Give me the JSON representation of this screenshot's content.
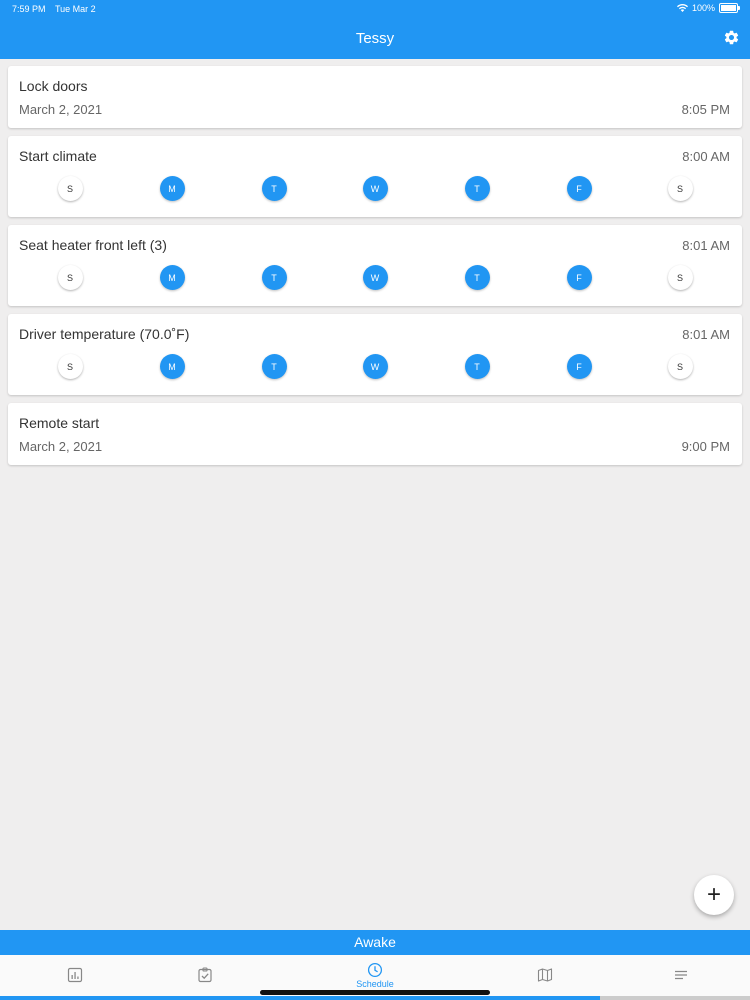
{
  "status": {
    "time": "7:59 PM",
    "date": "Tue Mar 2",
    "battery": "100%"
  },
  "header": {
    "title": "Tessy",
    "settings_icon": "gear-icon"
  },
  "day_letters": [
    "S",
    "M",
    "T",
    "W",
    "T",
    "F",
    "S"
  ],
  "schedules": [
    {
      "name": "Lock doors",
      "date": "March 2, 2021",
      "time": "8:05 PM"
    },
    {
      "name": "Start climate",
      "time": "8:00 AM",
      "days_active": [
        false,
        true,
        true,
        true,
        true,
        true,
        false
      ]
    },
    {
      "name": "Seat heater front left (3)",
      "time": "8:01 AM",
      "days_active": [
        false,
        true,
        true,
        true,
        true,
        true,
        false
      ]
    },
    {
      "name": "Driver temperature (70.0˚F)",
      "time": "8:01 AM",
      "days_active": [
        false,
        true,
        true,
        true,
        true,
        true,
        false
      ]
    },
    {
      "name": "Remote start",
      "date": "March 2, 2021",
      "time": "9:00 PM"
    }
  ],
  "fab": {
    "label": "+"
  },
  "banner": {
    "text": "Awake"
  },
  "tabs": [
    {
      "icon": "chart-icon",
      "label": ""
    },
    {
      "icon": "checklist-icon",
      "label": ""
    },
    {
      "icon": "clock-icon",
      "label": "Schedule",
      "active": true
    },
    {
      "icon": "map-icon",
      "label": ""
    },
    {
      "icon": "menu-lines-icon",
      "label": ""
    }
  ],
  "progress": 0.8,
  "colors": {
    "accent": "#2196f3",
    "background": "#efeeee"
  }
}
